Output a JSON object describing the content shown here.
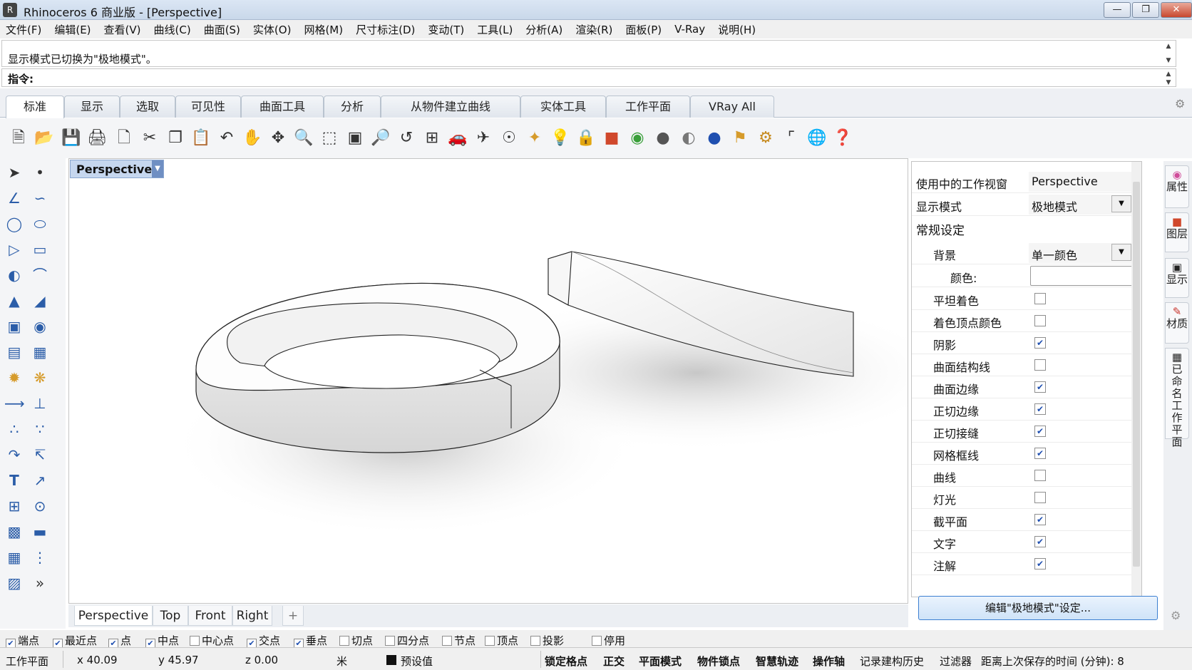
{
  "window": {
    "title": "Rhinoceros 6 商业版 - [Perspective]"
  },
  "menu": [
    "文件(F)",
    "编辑(E)",
    "查看(V)",
    "曲线(C)",
    "曲面(S)",
    "实体(O)",
    "网格(M)",
    "尺寸标注(D)",
    "变动(T)",
    "工具(L)",
    "分析(A)",
    "渲染(R)",
    "面板(P)",
    "V-Ray",
    "说明(H)"
  ],
  "command": {
    "history_line": "显示模式已切换为\"极地模式\"。",
    "prompt_label": "指令:"
  },
  "toolbar_tabs": [
    "标准",
    "显示",
    "选取",
    "可见性",
    "曲面工具",
    "分析",
    "从物件建立曲线",
    "实体工具",
    "工作平面",
    "VRay All"
  ],
  "viewport": {
    "title": "Perspective",
    "tabs": [
      "Perspective",
      "Top",
      "Front",
      "Right"
    ],
    "add_tab": "+"
  },
  "panel": {
    "active_viewport_label": "使用中的工作视窗",
    "active_viewport_value": "Perspective",
    "display_mode_label": "显示模式",
    "display_mode_value": "极地模式",
    "section_general": "常规设定",
    "background_label": "背景",
    "background_value": "单一颜色",
    "color_label": "颜色:",
    "checkboxes": [
      {
        "label": "平坦着色",
        "checked": false
      },
      {
        "label": "着色顶点颜色",
        "checked": false
      },
      {
        "label": "阴影",
        "checked": true
      },
      {
        "label": "曲面结构线",
        "checked": false
      },
      {
        "label": "曲面边缘",
        "checked": true
      },
      {
        "label": "正切边缘",
        "checked": true
      },
      {
        "label": "正切接缝",
        "checked": true
      },
      {
        "label": "网格框线",
        "checked": true
      },
      {
        "label": "曲线",
        "checked": false
      },
      {
        "label": "灯光",
        "checked": false
      },
      {
        "label": "截平面",
        "checked": true
      },
      {
        "label": "文字",
        "checked": true
      },
      {
        "label": "注解",
        "checked": true
      }
    ],
    "edit_button": "编辑\"极地模式\"设定..."
  },
  "side_tabs": [
    "属性",
    "图层",
    "显示",
    "材质",
    "已命名工作平面"
  ],
  "osnap": [
    {
      "label": "端点",
      "checked": true
    },
    {
      "label": "最近点",
      "checked": true
    },
    {
      "label": "点",
      "checked": true
    },
    {
      "label": "中点",
      "checked": true
    },
    {
      "label": "中心点",
      "checked": false
    },
    {
      "label": "交点",
      "checked": true
    },
    {
      "label": "垂点",
      "checked": true
    },
    {
      "label": "切点",
      "checked": false
    },
    {
      "label": "四分点",
      "checked": false
    },
    {
      "label": "节点",
      "checked": false
    },
    {
      "label": "顶点",
      "checked": false
    },
    {
      "label": "投影",
      "checked": false
    },
    {
      "label": "停用",
      "checked": false
    }
  ],
  "status": {
    "cplane": "工作平面",
    "x": "x 40.09",
    "y": "y 45.97",
    "z": "z 0.00",
    "units": "米",
    "layer": "预设值",
    "grid_snap": "锁定格点",
    "ortho": "正交",
    "planar": "平面模式",
    "osnap": "物件锁点",
    "smarttrack": "智慧轨迹",
    "gumball": "操作轴",
    "history": "记录建构历史",
    "filter": "过滤器",
    "save_time": "距离上次保存的时间 (分钟): 8"
  }
}
